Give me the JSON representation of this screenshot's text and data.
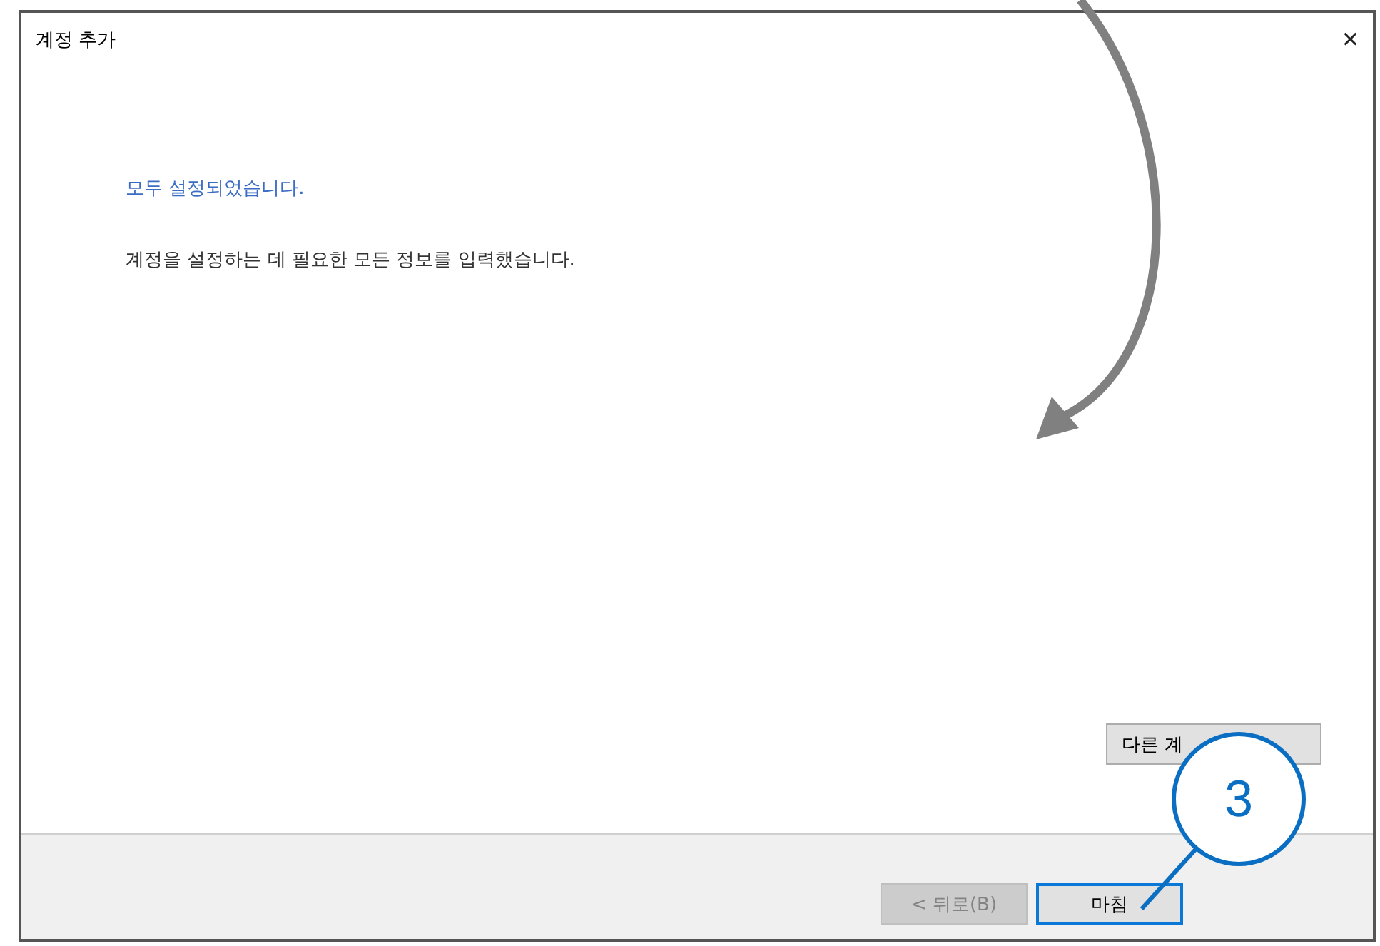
{
  "window": {
    "title": "계정 추가",
    "close": "×"
  },
  "heading": "모두 설정되었습니다.",
  "message": "계정을 설정하는 데 필요한 모든 정보를 입력했습니다.",
  "other_button": {
    "label": "다른 계"
  },
  "buttons": [
    {
      "label": "< 뒤로(B)",
      "disabled": true,
      "focused": false
    },
    {
      "label": "마침",
      "disabled": false,
      "focused": true
    }
  ],
  "callout": {
    "label": "3"
  }
}
